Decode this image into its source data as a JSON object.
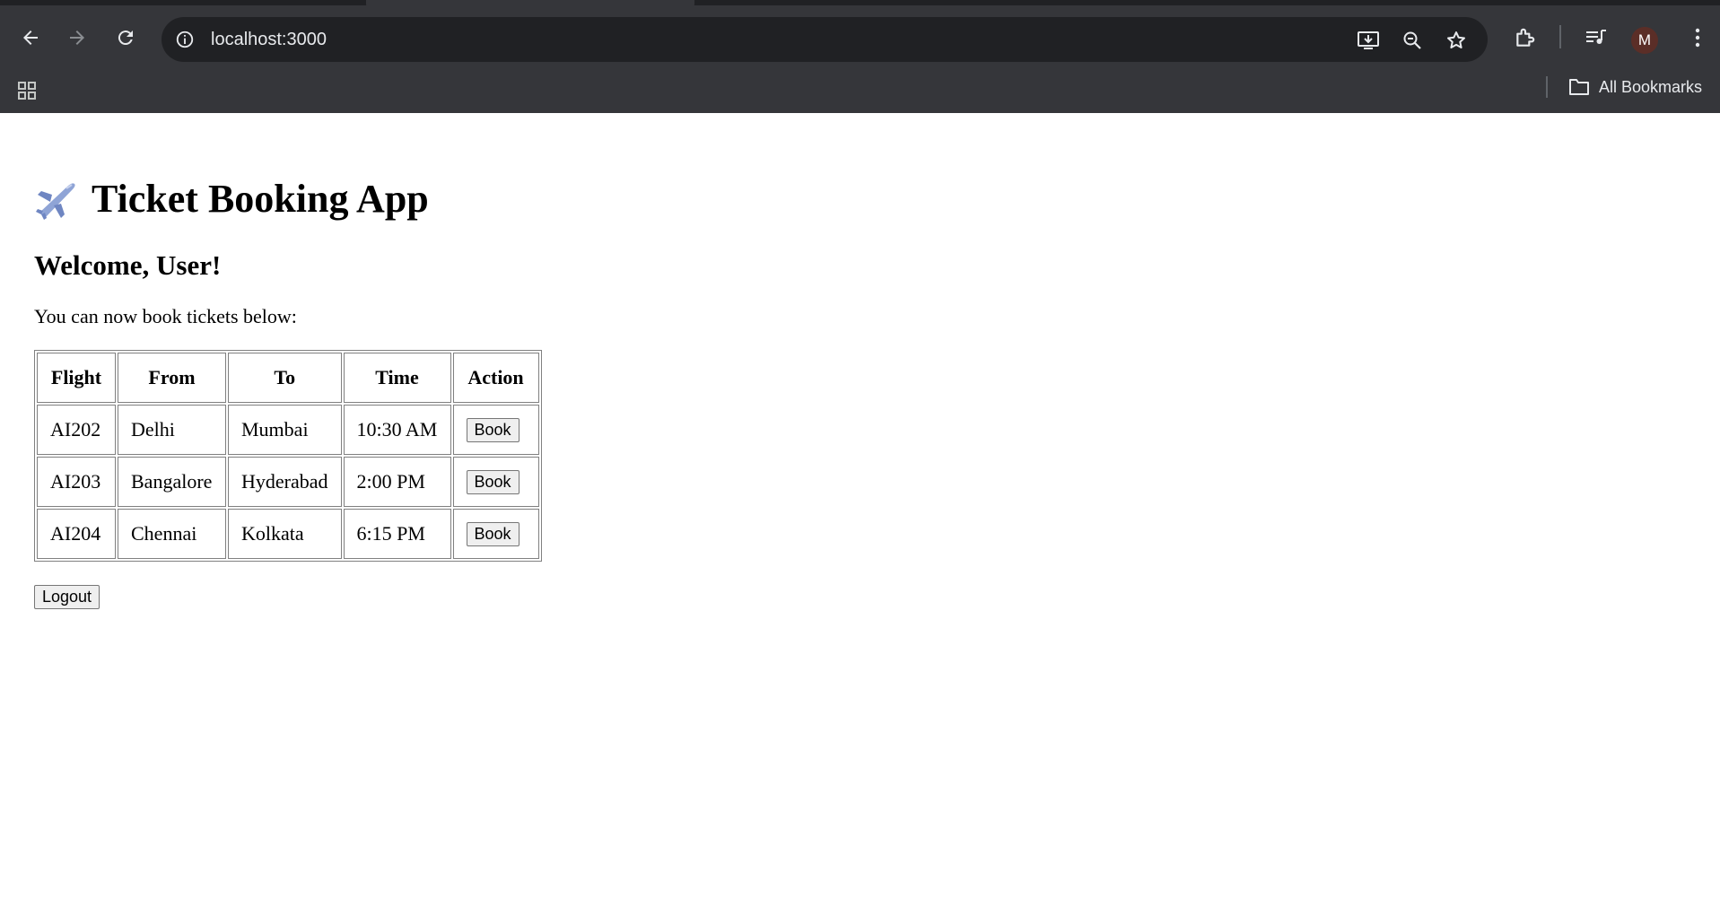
{
  "browser": {
    "url": "localhost:3000",
    "profile_initial": "M",
    "bookmarks_label": "All Bookmarks"
  },
  "page": {
    "title": "Ticket Booking App",
    "title_emoji": "airplane-icon",
    "welcome": "Welcome, User!",
    "intro": "You can now book tickets below:",
    "table": {
      "headers": [
        "Flight",
        "From",
        "To",
        "Time",
        "Action"
      ],
      "rows": [
        {
          "flight": "AI202",
          "from": "Delhi",
          "to": "Mumbai",
          "time": "10:30 AM",
          "action": "Book"
        },
        {
          "flight": "AI203",
          "from": "Bangalore",
          "to": "Hyderabad",
          "time": "2:00 PM",
          "action": "Book"
        },
        {
          "flight": "AI204",
          "from": "Chennai",
          "to": "Kolkata",
          "time": "6:15 PM",
          "action": "Book"
        }
      ]
    },
    "logout_label": "Logout"
  },
  "colors": {
    "chrome_bg": "#35363a",
    "omnibox_bg": "#202124",
    "avatar_bg": "#5b2e27"
  }
}
